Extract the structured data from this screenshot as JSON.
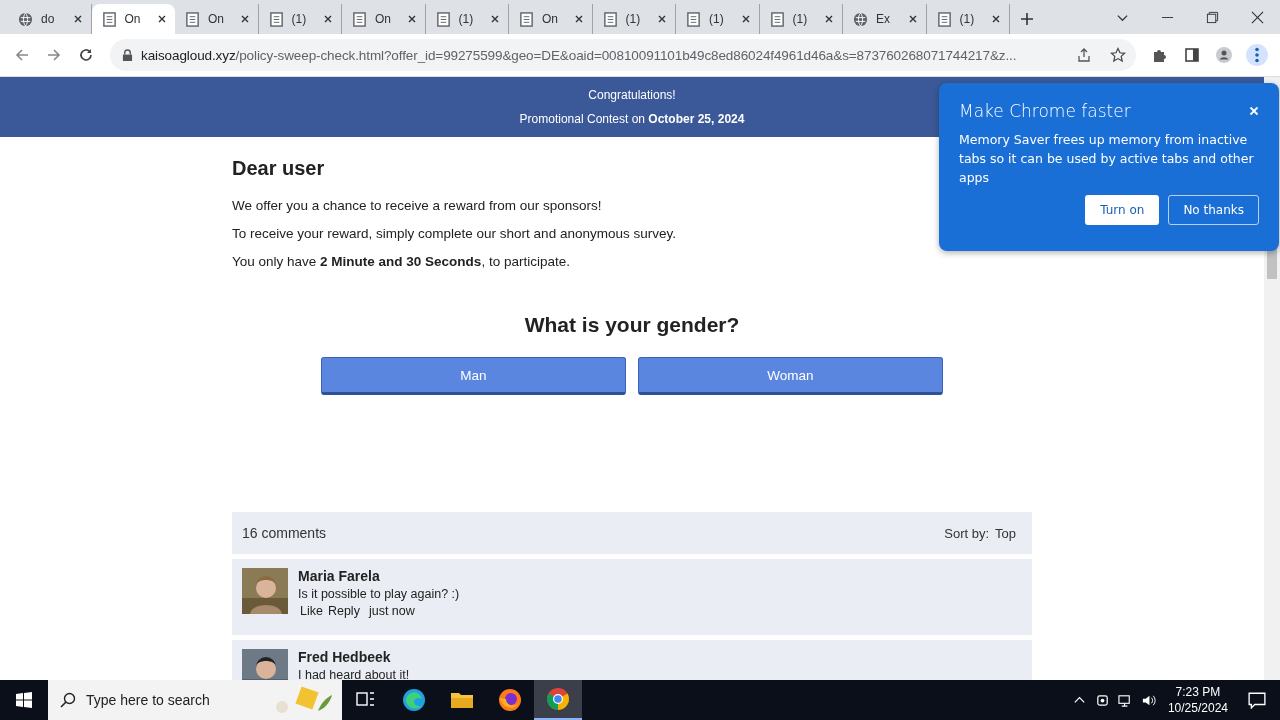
{
  "tabs": [
    {
      "title": "do",
      "kind": "globe",
      "selected": false
    },
    {
      "title": "On",
      "kind": "doc",
      "selected": true
    },
    {
      "title": "On",
      "kind": "doc",
      "selected": false
    },
    {
      "title": "(1)",
      "kind": "doc",
      "selected": false
    },
    {
      "title": "On",
      "kind": "doc",
      "selected": false
    },
    {
      "title": "(1)",
      "kind": "doc",
      "selected": false
    },
    {
      "title": "On",
      "kind": "doc",
      "selected": false
    },
    {
      "title": "(1)",
      "kind": "doc",
      "selected": false
    },
    {
      "title": "(1)",
      "kind": "doc",
      "selected": false
    },
    {
      "title": "(1)",
      "kind": "doc",
      "selected": false
    },
    {
      "title": "Ex",
      "kind": "globe",
      "selected": false
    },
    {
      "title": "(1)",
      "kind": "doc",
      "selected": false
    }
  ],
  "address": {
    "host": "kaisoagloud.xyz",
    "path": "/policy-sweep-check.html?offer_id=99275599&geo=DE&oaid=00810091101b49c8ed86024f4961d46a&s=873760268071744217&z..."
  },
  "banner": [
    "Congratulations!",
    "Promotional Contest on **October 25, 2024**"
  ],
  "greeting": "Dear user",
  "paragraphs": [
    "We offer you a chance to receive a reward from our sponsors!",
    "To receive your reward, simply complete our short and anonymous survey.",
    "You only have **2 Minute and 30 Seconds**, to participate."
  ],
  "question": "What is your gender?",
  "answers": [
    "Man",
    "Woman"
  ],
  "comments_header": {
    "count": "16 comments",
    "sort_label": "Sort by:",
    "sort_value": "Top"
  },
  "comments": [
    {
      "name": "Maria Farela",
      "text": "Is it possible to play again? :)",
      "like": "Like",
      "reply": "Reply",
      "time": "just now"
    },
    {
      "name": "Fred Hedbeek",
      "text": "I had heard about it!"
    }
  ],
  "popup": {
    "title": "Make Chrome faster",
    "body": "Memory Saver frees up memory from inactive tabs so it can be used by active tabs and other apps",
    "primary": "Turn on",
    "secondary": "No thanks"
  },
  "taskbar": {
    "search_placeholder": "Type here to search",
    "apps": [
      {
        "kind": "taskview",
        "selected": false
      },
      {
        "kind": "edge",
        "selected": false
      },
      {
        "kind": "files",
        "selected": false
      },
      {
        "kind": "firefox",
        "selected": false
      },
      {
        "kind": "chrome",
        "selected": true
      }
    ],
    "time": "7:23 PM",
    "date": "10/25/2024"
  }
}
